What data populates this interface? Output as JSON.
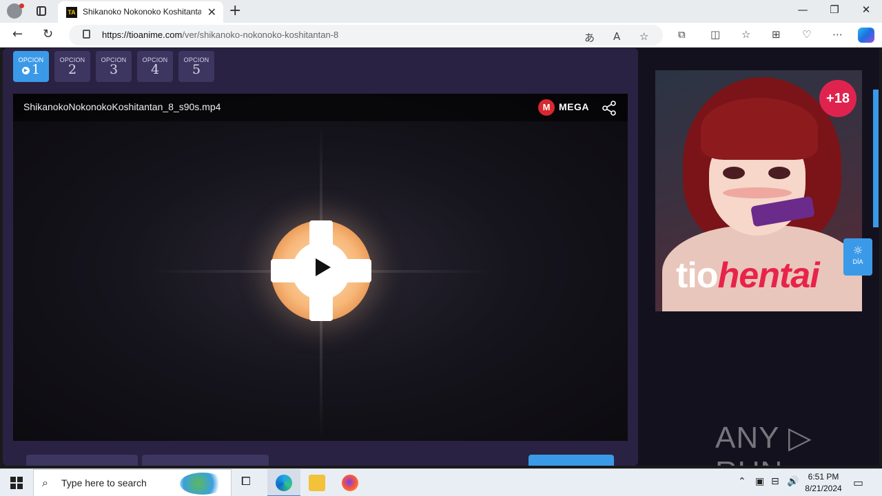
{
  "browser": {
    "tab_title": "Shikanoko Nokonoko Koshitanta",
    "favicon_text": "TA",
    "url_host": "https://tioanime.com",
    "url_path": "/ver/shikanoko-nokonoko-koshitantan-8",
    "new_tab": "+",
    "close_tab": "✕",
    "window_controls": {
      "minimize": "—",
      "restore": "❐",
      "close": "✕"
    }
  },
  "options": [
    {
      "label": "OPCION",
      "number": "1",
      "active": true
    },
    {
      "label": "OPCION",
      "number": "2",
      "active": false
    },
    {
      "label": "OPCION",
      "number": "3",
      "active": false
    },
    {
      "label": "OPCION",
      "number": "4",
      "active": false
    },
    {
      "label": "OPCION",
      "number": "5",
      "active": false
    }
  ],
  "player": {
    "file_name": "ShikanokoNokonokoKoshitantan_8_s90s.mp4",
    "provider_logo": "M",
    "provider": "MEGA"
  },
  "ad": {
    "badge": "+18",
    "brand_a": "tio",
    "brand_b": "hentai"
  },
  "theme_toggle": {
    "label": "DÍA",
    "icon": "sun-icon"
  },
  "watermark": "ANY ▷ RUN",
  "taskbar": {
    "search_placeholder": "Type here to search",
    "time": "6:51 PM",
    "date": "8/21/2024"
  },
  "colors": {
    "accent": "#3b9ae8",
    "panel": "#2a2243",
    "page_bg": "#14111f",
    "mega_red": "#d9272e",
    "brand_pink": "#e8234a"
  }
}
